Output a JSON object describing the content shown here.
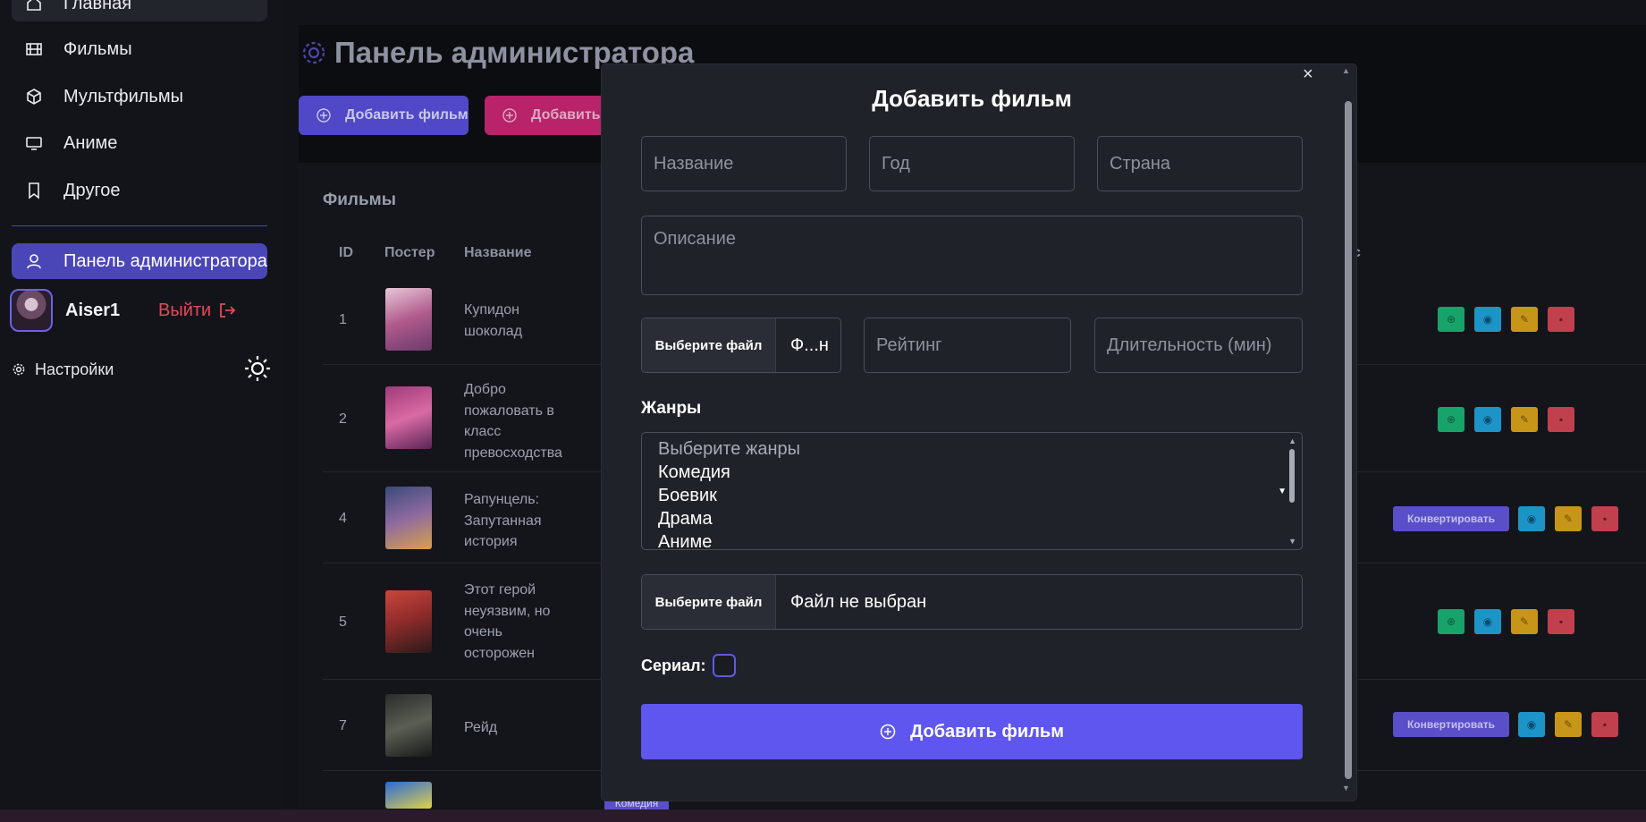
{
  "sidebar": {
    "nav": [
      {
        "label": "Главная",
        "icon": "home-icon"
      },
      {
        "label": "Фильмы",
        "icon": "film-icon"
      },
      {
        "label": "Мультфильмы",
        "icon": "cube-icon"
      },
      {
        "label": "Аниме",
        "icon": "monitor-icon"
      },
      {
        "label": "Другое",
        "icon": "bookmark-icon"
      }
    ],
    "admin_label": "Панель администратора",
    "username": "Aiser1",
    "logout_label": "Выйти",
    "settings_label": "Настройки"
  },
  "main": {
    "title": "Панель администратора",
    "add_film_label": "Добавить фильм",
    "add_genre_label": "Добавить ж",
    "films_title": "Фильмы",
    "columns": [
      "ID",
      "Постер",
      "Название",
      "с"
    ],
    "rows": [
      {
        "id": "1",
        "name": "Купидон шоколад",
        "actions": "standard"
      },
      {
        "id": "2",
        "name": "Добро пожаловать в класс превосходства",
        "actions": "standard"
      },
      {
        "id": "4",
        "name": "Рапунцель: Запутанная история",
        "actions": "convert"
      },
      {
        "id": "5",
        "name": "Этот герой неуязвим, но очень осторожен",
        "actions": "standard"
      },
      {
        "id": "7",
        "name": "Рейд",
        "actions": "convert"
      }
    ],
    "convert_label": "Конвертировать",
    "partial_genre_tag": "Комедия"
  },
  "modal": {
    "title": "Добавить фильм",
    "close": "×",
    "name_placeholder": "Название",
    "year_placeholder": "Год",
    "country_placeholder": "Страна",
    "description_placeholder": "Описание",
    "file_button": "Выберите файл",
    "poster_file_value": "Ф...н",
    "rating_placeholder": "Рейтинг",
    "duration_placeholder": "Длительность (мин)",
    "genres_label": "Жанры",
    "genres_placeholder": "Выберите жанры",
    "genres": [
      "Комедия",
      "Боевик",
      "Драма",
      "Аниме"
    ],
    "video_file_value": "Файл не выбран",
    "serial_label": "Сериал:",
    "submit_label": "Добавить фильм"
  },
  "colors": {
    "accent": "#5f56f0",
    "sidebar_active": "#4b46b8",
    "logout": "#e34a57",
    "action_green": "#18a36a",
    "action_blue": "#1d94c8",
    "action_yellow": "#c79619",
    "action_red": "#c0404e"
  }
}
